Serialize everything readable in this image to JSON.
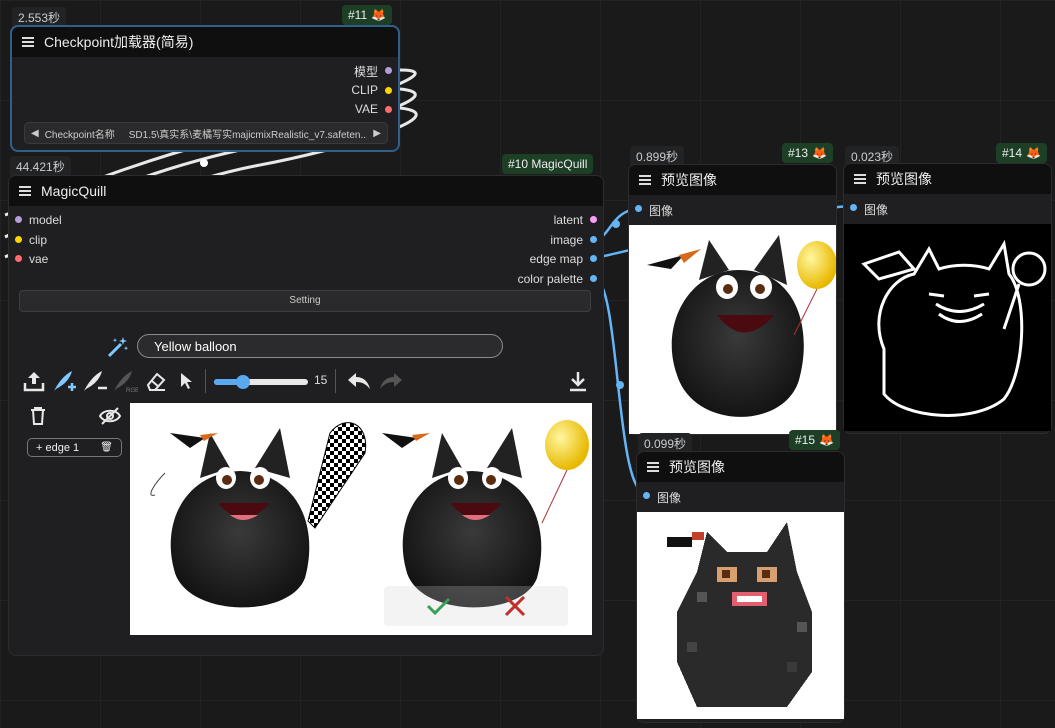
{
  "colors": {
    "model": "#b39ddb",
    "clip": "#ffd500",
    "vae": "#ff6e6e",
    "latent": "#ff9cf9",
    "image": "#64b5f6",
    "link_blue": "#64b5f6",
    "badge_bg": "#1d3f26",
    "selected_border": "#2f5f8a"
  },
  "node11": {
    "timing": "2.553秒",
    "badge": "#11",
    "title": "Checkpoint加载器(简易)",
    "outputs": [
      "模型",
      "CLIP",
      "VAE"
    ],
    "ckpt_label": "Checkpoint名称",
    "ckpt_value": "SD1.5\\真实系\\麦橘写实majicmixRealistic_v7.safeten..."
  },
  "node10": {
    "timing": "44.421秒",
    "badge": "#10 MagicQuill",
    "title": "MagicQuill",
    "inputs": [
      "model",
      "clip",
      "vae"
    ],
    "outputs": [
      "latent",
      "image",
      "edge map",
      "color palette"
    ],
    "setting_label": "Setting",
    "prompt_value": "Yellow balloon",
    "brush_size": "15",
    "edge_layer": "+ edge 1"
  },
  "node13": {
    "timing": "0.899秒",
    "badge": "#13",
    "title": "预览图像",
    "input": "图像"
  },
  "node14": {
    "timing": "0.023秒",
    "badge": "#14",
    "title": "预览图像",
    "input": "图像"
  },
  "node15": {
    "timing": "0.099秒",
    "badge": "#15",
    "title": "预览图像",
    "input": "图像"
  },
  "icons": [
    "menu-icon",
    "fox-icon",
    "magic-wand-icon",
    "upload-icon",
    "brush-add-icon",
    "brush-subtract-icon",
    "rgb-brush-icon",
    "eraser-icon",
    "cursor-icon",
    "undo-icon",
    "redo-icon",
    "download-icon",
    "trash-icon",
    "eye-off-icon",
    "accept-check-icon",
    "reject-x-icon"
  ]
}
